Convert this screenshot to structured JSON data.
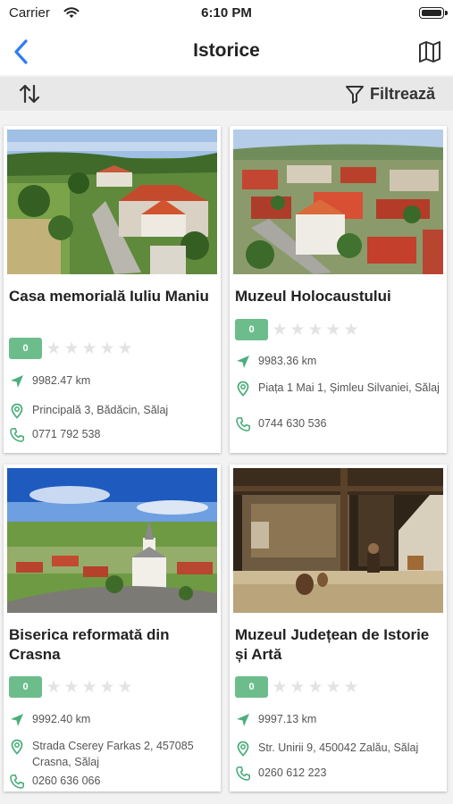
{
  "status_bar": {
    "carrier": "Carrier",
    "time": "6:10 PM"
  },
  "nav": {
    "title": "Istorice"
  },
  "toolbar": {
    "filter_label": "Filtrează"
  },
  "accent_colors": {
    "primary": "#2f7cf6",
    "rating_badge": "#6dbd8c",
    "info_icon": "#4caf7d"
  },
  "cards": [
    {
      "title": "Casa memorială Iuliu Maniu",
      "rating": "0",
      "distance": "9982.47 km",
      "address": "Principală 3, Bădăcin, Sălaj",
      "phone": "0771 792 538"
    },
    {
      "title": "Muzeul Holocaustului",
      "rating": "0",
      "distance": "9983.36 km",
      "address": "Piața 1 Mai 1, Șimleu Silvaniei, Sălaj",
      "phone": "0744 630 536"
    },
    {
      "title": "Biserica reformată din Crasna",
      "rating": "0",
      "distance": "9992.40 km",
      "address": "Strada Cserey Farkas 2, 457085 Crasna, Sălaj",
      "phone": "0260 636 066"
    },
    {
      "title": "Muzeul Județean de Istorie și Artă",
      "rating": "0",
      "distance": "9997.13 km",
      "address": "Str. Unirii 9, 450042 Zalău, Sălaj",
      "phone": "0260 612 223"
    }
  ]
}
